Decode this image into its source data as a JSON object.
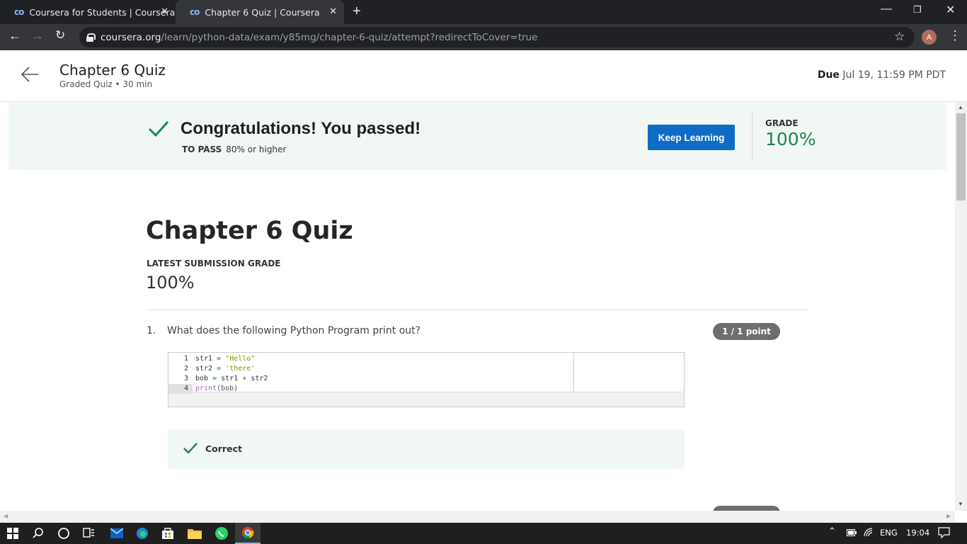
{
  "browser": {
    "tabs": [
      {
        "favicon": "coursera-co-icon",
        "title": "Coursera for Students | Coursera",
        "active": false
      },
      {
        "favicon": "coursera-co-icon",
        "title": "Chapter 6 Quiz | Coursera",
        "active": true
      }
    ],
    "url_host": "coursera.org",
    "url_path": "/learn/python-data/exam/y85mg/chapter-6-quiz/attempt?redirectToCover=true",
    "profile_initial": "A"
  },
  "header": {
    "title": "Chapter 6 Quiz",
    "subtitle": "Graded Quiz • 30 min",
    "due_label": "Due",
    "due_value": "Jul 19, 11:59 PM PDT"
  },
  "banner": {
    "heading": "Congratulations! You passed!",
    "to_pass_label": "TO PASS",
    "to_pass_value": "80% or higher",
    "button_label": "Keep Learning",
    "grade_label": "GRADE",
    "grade_value": "100%",
    "colors": {
      "background": "#f1f7f5",
      "grade": "#1f8354",
      "button": "#0f6cc4"
    }
  },
  "main": {
    "quiz_title": "Chapter 6 Quiz",
    "latest_grade_label": "LATEST SUBMISSION GRADE",
    "latest_grade_value": "100%"
  },
  "questions": [
    {
      "number": "1.",
      "text": "What does the following Python Program print out?",
      "points": "1 / 1 point",
      "code_lines": [
        {
          "num": "1",
          "code": "str1 = \"Hello\""
        },
        {
          "num": "2",
          "code": "str2 = 'there'"
        },
        {
          "num": "3",
          "code": "bob = str1 + str2"
        },
        {
          "num": "4",
          "code": "print(bob)"
        }
      ],
      "feedback": "Correct",
      "correct": true
    }
  ],
  "taskbar": {
    "apps": [
      "windows-start-icon",
      "search-icon",
      "cortana-icon",
      "task-view-icon",
      "mail-icon",
      "edge-icon",
      "store-icon",
      "file-explorer-icon",
      "whatsapp-icon",
      "chrome-icon"
    ],
    "language": "ENG",
    "time": "19:04"
  }
}
